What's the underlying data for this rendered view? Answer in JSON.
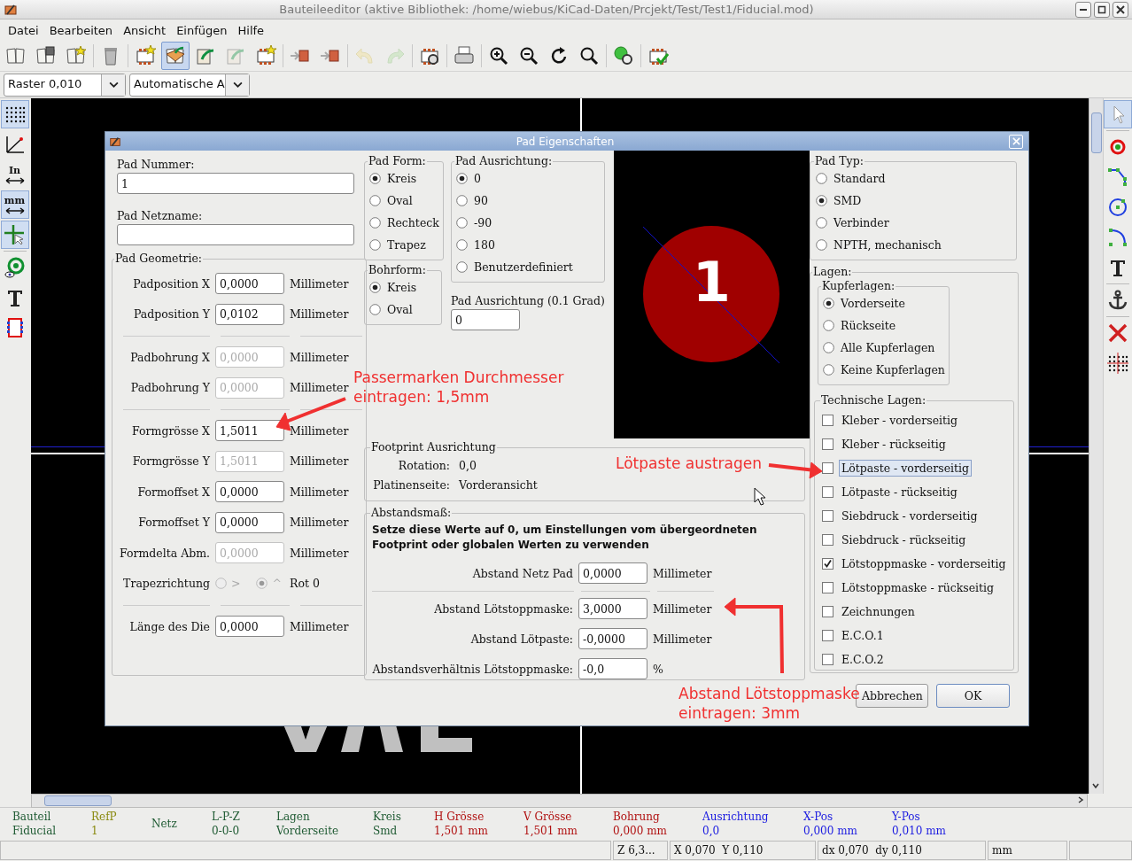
{
  "window": {
    "title": "Bauteileeditor (aktive Bibliothek: /home/wiebus/KiCad-Daten/Prcjekt/Test/Test1/Fiducial.mod)"
  },
  "menu": [
    "Datei",
    "Bearbeiten",
    "Ansicht",
    "Einfügen",
    "Hilfe"
  ],
  "toolbar": [
    {
      "selected": false,
      "disabled": false
    },
    {
      "selected": false,
      "disabled": false
    },
    {
      "selected": false,
      "disabled": false
    },
    {
      "selected": false,
      "disabled": false
    },
    {
      "selected": false,
      "disabled": false
    },
    {
      "selected": true,
      "disabled": false
    },
    {
      "selected": false,
      "disabled": false
    },
    {
      "selected": false,
      "disabled": true
    },
    {
      "selected": false,
      "disabled": false
    },
    {
      "selected": false,
      "disabled": false
    },
    {
      "selected": false,
      "disabled": false
    },
    {
      "selected": false,
      "disabled": true
    },
    {
      "selected": false,
      "disabled": true
    },
    {
      "selected": false,
      "disabled": false
    },
    {
      "selected": false,
      "disabled": false
    },
    {
      "selected": false,
      "disabled": false
    },
    {
      "selected": false,
      "disabled": false
    },
    {
      "selected": false,
      "disabled": false
    },
    {
      "selected": false,
      "disabled": false
    },
    {
      "selected": false,
      "disabled": false
    },
    {
      "selected": false,
      "disabled": false
    }
  ],
  "options_bar": {
    "grid": "Raster 0,010",
    "zoom": "Automatische A"
  },
  "left_toolbar": [
    {
      "selected": true
    },
    {
      "selected": false
    },
    {
      "selected": false,
      "label": "In"
    },
    {
      "selected": true,
      "label": "mm"
    },
    {
      "selected": true
    },
    {
      "selected": false
    },
    {
      "selected": false
    },
    {
      "selected": false
    }
  ],
  "right_toolbar": [
    {
      "selected": true
    },
    {
      "selected": false
    },
    {
      "selected": false
    },
    {
      "selected": false
    },
    {
      "selected": false
    },
    {
      "selected": false
    },
    {
      "selected": false
    },
    {
      "selected": false
    },
    {
      "selected": false
    }
  ],
  "dialog": {
    "title": "Pad Eigenschaften",
    "pad_number": {
      "label": "Pad Nummer:",
      "value": "1"
    },
    "net_name": {
      "label": "Pad Netzname:"
    },
    "geometry": {
      "title": "Pad Geometrie:",
      "rows": [
        {
          "kind": "field",
          "label": "Padposition X",
          "value": "0,0000",
          "unit": "Millimeter",
          "disabled": false
        },
        {
          "kind": "field",
          "label": "Padposition Y",
          "value": "0,0102",
          "unit": "Millimeter",
          "disabled": false
        },
        {
          "kind": "separator"
        },
        {
          "kind": "field",
          "label": "Padbohrung X",
          "value": "0,0000",
          "unit": "Millimeter",
          "disabled": true
        },
        {
          "kind": "field",
          "label": "Padbohrung Y",
          "value": "0,0000",
          "unit": "Millimeter",
          "disabled": true
        },
        {
          "kind": "separator"
        },
        {
          "kind": "field",
          "label": "Formgrösse X",
          "value": "1,5011",
          "unit": "Millimeter",
          "disabled": false
        },
        {
          "kind": "field",
          "label": "Formgrösse Y",
          "value": "1,5011",
          "unit": "Millimeter",
          "disabled": true
        },
        {
          "kind": "field",
          "label": "Formoffset X",
          "value": "0,0000",
          "unit": "Millimeter",
          "disabled": false
        },
        {
          "kind": "field",
          "label": "Formoffset Y",
          "value": "0,0000",
          "unit": "Millimeter",
          "disabled": false
        },
        {
          "kind": "field",
          "label": "Formdelta Abm.",
          "value": "0,0000",
          "unit": "Millimeter",
          "disabled": true
        },
        {
          "kind": "radios",
          "label": "Trapezrichtung",
          "disabled": true,
          "options": [
            {
              "label": ">",
              "selected": false
            },
            {
              "label": "^",
              "selected": true
            }
          ],
          "unit": "Rot 0"
        },
        {
          "kind": "separator"
        },
        {
          "kind": "field",
          "label": "Länge des Die",
          "value": "0,0000",
          "unit": "Millimeter",
          "disabled": false
        }
      ]
    },
    "pad_shape": {
      "title": "Pad Form:",
      "options": [
        {
          "label": "Kreis",
          "selected": true
        },
        {
          "label": "Oval",
          "selected": false
        },
        {
          "label": "Rechteck",
          "selected": false
        },
        {
          "label": "Trapez",
          "selected": false
        }
      ]
    },
    "drill_shape": {
      "title": "Bohrform:",
      "options": [
        {
          "label": "Kreis",
          "selected": true
        },
        {
          "label": "Oval",
          "selected": false
        }
      ]
    },
    "orientation": {
      "title": "Pad Ausrichtung:",
      "options": [
        {
          "label": "0",
          "selected": true
        },
        {
          "label": "90",
          "selected": false
        },
        {
          "label": "-90",
          "selected": false
        },
        {
          "label": "180",
          "selected": false
        },
        {
          "label": "Benutzerdefiniert",
          "selected": false
        }
      ]
    },
    "orientation_field": {
      "label": "Pad Ausrichtung (0.1 Grad)",
      "value": "0"
    },
    "preview": {
      "pad_label": "1"
    },
    "footprint": {
      "title": "Footprint Ausrichtung",
      "rows": [
        {
          "label": "Rotation:",
          "value": "0,0"
        },
        {
          "label": "Platinenseite:",
          "value": "Vorderansicht"
        }
      ]
    },
    "clearance": {
      "title": "Abstandsmaß:",
      "note": "Setze diese Werte auf 0, um Einstellungen vom übergeordneten Footprint oder globalen Werten zu verwenden",
      "rows": [
        {
          "kind": "field",
          "label": "Abstand Netz Pad",
          "value": "0,0000",
          "unit": "Millimeter"
        },
        {
          "kind": "separator"
        },
        {
          "kind": "field",
          "label": "Abstand Lötstoppmaske:",
          "value": "3,0000",
          "unit": "Millimeter"
        },
        {
          "kind": "field",
          "label": "Abstand Lötpaste:",
          "value": "-0,0000",
          "unit": "Millimeter"
        },
        {
          "kind": "field",
          "label": "Abstandsverhältnis Lötstoppmaske:",
          "value": "-0,0",
          "unit": "%"
        }
      ]
    },
    "pad_type": {
      "title": "Pad Typ:",
      "options": [
        {
          "label": "Standard",
          "selected": false
        },
        {
          "label": "SMD",
          "selected": true
        },
        {
          "label": "Verbinder",
          "selected": false
        },
        {
          "label": "NPTH, mechanisch",
          "selected": false
        }
      ]
    },
    "layers": {
      "title": "Lagen:",
      "copper": {
        "title": "Kupferlagen:",
        "options": [
          {
            "label": "Vorderseite",
            "selected": true
          },
          {
            "label": "Rückseite",
            "selected": false
          },
          {
            "label": "Alle Kupferlagen",
            "selected": false
          },
          {
            "label": "Keine Kupferlagen",
            "selected": false
          }
        ]
      },
      "technical": {
        "title": "Technische Lagen:",
        "items": [
          {
            "label": "Kleber - vorderseitig",
            "checked": false,
            "focused": false
          },
          {
            "label": "Kleber - rückseitig",
            "checked": false,
            "focused": false
          },
          {
            "label": "Lötpaste - vorderseitig",
            "checked": false,
            "focused": true
          },
          {
            "label": "Lötpaste - rückseitig",
            "checked": false,
            "focused": false
          },
          {
            "label": "Siebdruck - vorderseitig",
            "checked": false,
            "focused": false
          },
          {
            "label": "Siebdruck - rückseitig",
            "checked": false,
            "focused": false
          },
          {
            "label": "Lötstoppmaske - vorderseitig",
            "checked": true,
            "focused": false
          },
          {
            "label": "Lötstoppmaske - rückseitig",
            "checked": false,
            "focused": false
          },
          {
            "label": "Zeichnungen",
            "checked": false,
            "focused": false
          },
          {
            "label": "E.C.O.1",
            "checked": false,
            "focused": false
          },
          {
            "label": "E.C.O.2",
            "checked": false,
            "focused": false
          }
        ]
      }
    },
    "buttons": [
      {
        "label": "Abbrechen",
        "default": false
      },
      {
        "label": "OK",
        "default": true
      }
    ]
  },
  "annotations": [
    {
      "kind": "diameter",
      "text": "Passermarken Durchmesser\neintragen: 1,5mm"
    },
    {
      "kind": "paste",
      "text": "Lötpaste austragen"
    },
    {
      "kind": "mask",
      "text": "Abstand Lötstoppmaske\neintragen: 3mm"
    }
  ],
  "message_panel": [
    {
      "label": "Bauteil",
      "value": "Fiducial",
      "color": "#1e5a32"
    },
    {
      "label": "RefP",
      "value": "1",
      "color": "#8a8a10"
    },
    {
      "label": "Netz",
      "color": "#1e5a32"
    },
    {
      "label": "L-P-Z",
      "value": "0-0-0",
      "color": "#1e5a32"
    },
    {
      "label": "Lagen",
      "value": "Vorderseite",
      "color": "#1e5a32"
    },
    {
      "label": "Kreis",
      "value": "Smd",
      "color": "#1e5a32"
    },
    {
      "label": "H Grösse",
      "value": "1,501 mm",
      "color": "#b01010"
    },
    {
      "label": "V Grösse",
      "value": "1,501 mm",
      "color": "#b01010"
    },
    {
      "label": "Bohrung",
      "value": "0,000 mm",
      "color": "#b01010"
    },
    {
      "label": "Ausrichtung",
      "value": "0,0",
      "color": "#1a1ae0"
    },
    {
      "label": "X-Pos",
      "value": "0,000 mm",
      "color": "#1a1ae0"
    },
    {
      "label": "Y-Pos",
      "value": "0,010 mm",
      "color": "#1a1ae0"
    }
  ],
  "status_bar": {
    "zoom": "Z 6,3...",
    "position": "X 0,070  Y 0,110",
    "delta": "dx 0,070  dy 0,110",
    "units": "mm"
  }
}
